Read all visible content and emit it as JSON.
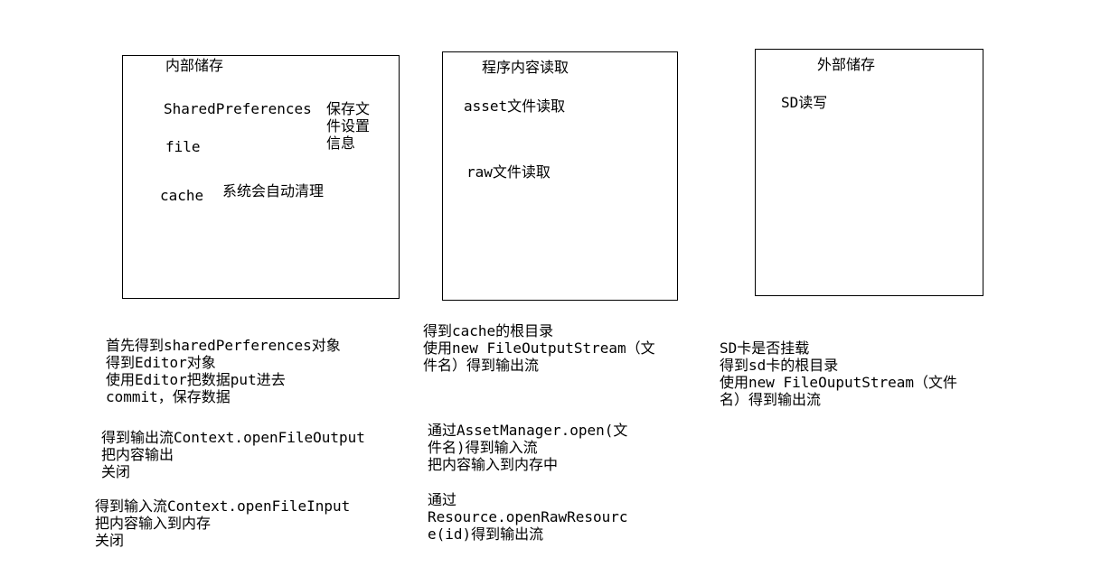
{
  "boxes": {
    "internal": {
      "title": "内部储存",
      "sp_label": "SharedPreferences",
      "sp_desc": [
        "保存文",
        "件设置",
        "信息"
      ],
      "file_label": "file",
      "cache_label": "cache",
      "cache_desc": "系统会自动清理"
    },
    "program": {
      "title": "程序内容读取",
      "asset_label": "asset文件读取",
      "raw_label": "raw文件读取"
    },
    "external": {
      "title": "外部储存",
      "sd_label": "SD读写"
    }
  },
  "notes": {
    "shared_prefs_steps": [
      "首先得到sharedPerferences对象",
      "得到Editor对象",
      "使用Editor把数据put进去",
      "commit，保存数据"
    ],
    "file_output_steps": [
      "得到输出流Context.openFileOutput",
      "把内容输出",
      "关闭"
    ],
    "file_input_steps": [
      "得到输入流Context.openFileInput",
      "把内容输入到内存",
      "关闭"
    ],
    "cache_steps": [
      "得到cache的根目录",
      "使用new FileOutputStream（文",
      "件名）得到输出流"
    ],
    "asset_steps": [
      "通过AssetManager.open(文",
      "件名)得到输入流",
      "把内容输入到内存中"
    ],
    "raw_steps": [
      "通过",
      "Resource.openRawResourc",
      "e(id)得到输出流"
    ],
    "sd_steps": [
      "SD卡是否挂载",
      "得到sd卡的根目录",
      "使用new FileOuputStream（文件",
      "名）得到输出流"
    ]
  }
}
